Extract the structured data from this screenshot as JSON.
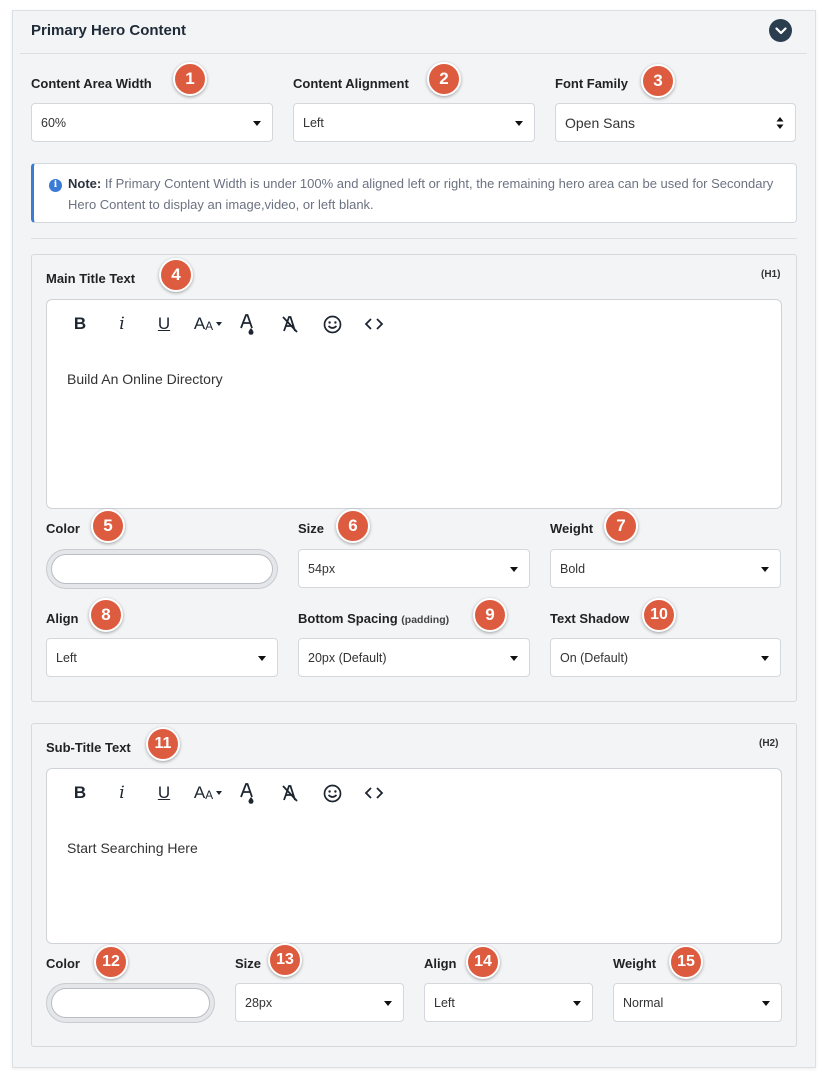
{
  "panel": {
    "title": "Primary Hero Content",
    "content_width": {
      "label": "Content Area Width",
      "value": "60%",
      "badge": "1"
    },
    "content_alignment": {
      "label": "Content Alignment",
      "value": "Left",
      "badge": "2"
    },
    "font_family": {
      "label": "Font Family",
      "value": "Open Sans",
      "badge": "3"
    },
    "note": {
      "prefix": "Note:",
      "text": "If Primary Content Width is under 100% and aligned left or right, the remaining hero area can be used for Secondary Hero Content to display an image,video, or left blank."
    }
  },
  "toolbar": {
    "bold": "B",
    "italic": "i",
    "underline": "U",
    "font_size": "AA",
    "text_color": "A",
    "clear_format": "A",
    "emoji": "☺",
    "code": "<>"
  },
  "main_title": {
    "label": "Main Title Text",
    "badge": "4",
    "tag": "(H1)",
    "content": "Build An Online Directory",
    "color": {
      "label": "Color",
      "badge": "5"
    },
    "size": {
      "label": "Size",
      "badge": "6",
      "value": "54px"
    },
    "weight": {
      "label": "Weight",
      "badge": "7",
      "value": "Bold"
    },
    "align": {
      "label": "Align",
      "badge": "8",
      "value": "Left"
    },
    "bottom_spacing": {
      "label": "Bottom Spacing",
      "sub": "(padding)",
      "badge": "9",
      "value": "20px (Default)"
    },
    "text_shadow": {
      "label": "Text Shadow",
      "badge": "10",
      "value": "On (Default)"
    }
  },
  "sub_title": {
    "label": "Sub-Title Text",
    "badge": "11",
    "tag": "(H2)",
    "content": "Start Searching Here",
    "color": {
      "label": "Color",
      "badge": "12"
    },
    "size": {
      "label": "Size",
      "badge": "13",
      "value": "28px"
    },
    "align": {
      "label": "Align",
      "badge": "14",
      "value": "Left"
    },
    "weight": {
      "label": "Weight",
      "badge": "15",
      "value": "Normal"
    }
  },
  "colors": {
    "badge": "#dd5b3f",
    "header_button": "#2b3e50",
    "note_accent": "#3a7bd5"
  }
}
